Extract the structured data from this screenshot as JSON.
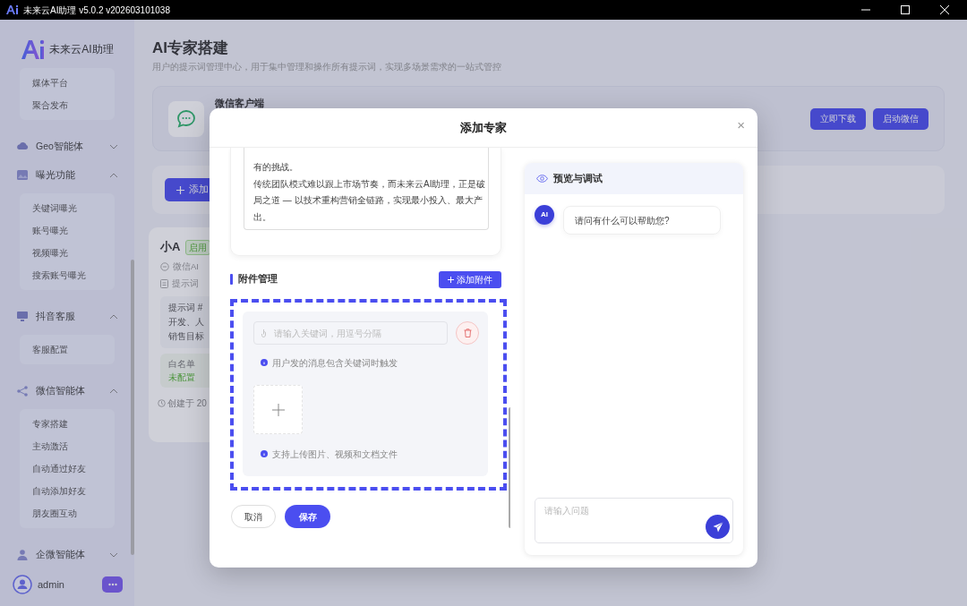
{
  "window": {
    "title": "未来云AI助理 v5.0.2 v202603101038"
  },
  "sidebar": {
    "brand": "未来云AI助理",
    "groups": [
      {
        "items": [
          {
            "label": "媒体平台"
          },
          {
            "label": "聚合发布"
          }
        ]
      },
      {
        "label": "Geo智能体",
        "expanded": false
      },
      {
        "label": "曝光功能",
        "expanded": true,
        "items": [
          {
            "label": "关键词曝光"
          },
          {
            "label": "账号曝光"
          },
          {
            "label": "视频曝光"
          },
          {
            "label": "搜索账号曝光"
          }
        ]
      },
      {
        "label": "抖音客服",
        "expanded": true,
        "items": [
          {
            "label": "客服配置"
          }
        ]
      },
      {
        "label": "微信智能体",
        "expanded": true,
        "items": [
          {
            "label": "专家搭建"
          },
          {
            "label": "主动激活"
          },
          {
            "label": "自动通过好友"
          },
          {
            "label": "自动添加好友"
          },
          {
            "label": "朋友圈互动"
          }
        ]
      },
      {
        "label": "企微智能体",
        "expanded": false
      }
    ],
    "user": "admin"
  },
  "main": {
    "title": "AI专家搭建",
    "subtitle": "用户的提示词管理中心，用于集中管理和操作所有提示词，实现多场景需求的一站式管控",
    "client": {
      "name": "微信客户端",
      "buttons": [
        "立即下载",
        "启动微信"
      ]
    },
    "add_button": "添加",
    "expert_card": {
      "name": "小A",
      "status": "启用",
      "channel": "微信AI",
      "prompt_label": "提示词",
      "prompt_lines": [
        "提示词 #",
        "开发、人",
        "销售目标"
      ],
      "whitelist_label": "白名单",
      "whitelist_value": "未配置",
      "created": "创建于 20"
    }
  },
  "modal": {
    "title": "添加专家",
    "close": "×",
    "prompt_paragraphs": [
      "有的挑战。",
      "传统团队模式难以跟上市场节奏，而未来云AI助理，正是破局之道 — 以技术重构营销全链路，实现最小投入、最大产出。"
    ],
    "attachments": {
      "title": "附件管理",
      "add_button": "添加附件",
      "keyword_placeholder": "请输入关键词，用逗号分隔",
      "keyword_hint": "用户发的消息包含关键词时触发",
      "upload_hint": "支持上传图片、视频和文档文件"
    },
    "actions": {
      "cancel": "取消",
      "save": "保存"
    },
    "preview": {
      "title": "预览与调试",
      "messages": [
        {
          "sender": "AI",
          "text": "请问有什么可以帮助您?"
        }
      ],
      "input_placeholder": "请输入问题"
    }
  }
}
